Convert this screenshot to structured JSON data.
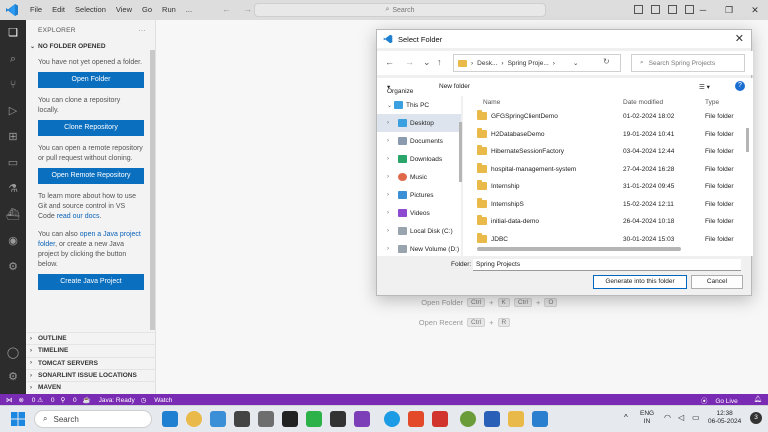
{
  "titlebar": {
    "menu": [
      "File",
      "Edit",
      "Selection",
      "View",
      "Go",
      "Run",
      "..."
    ],
    "search_placeholder": "Search"
  },
  "explorer": {
    "header": "EXPLORER",
    "section": "NO FOLDER OPENED",
    "text1": "You have not yet opened a folder.",
    "open_folder": "Open Folder",
    "text2": "You can clone a repository locally.",
    "clone_repo": "Clone Repository",
    "text3": "You can open a remote repository or pull request without cloning.",
    "open_remote": "Open Remote Repository",
    "text4_a": "To learn more about how to use Git and source control in VS Code ",
    "text4_link": "read our docs",
    "text4_b": ".",
    "text5_a": "You can also ",
    "text5_link": "open a Java project folder",
    "text5_b": ", or create a new Java project by clicking the button below.",
    "create_java": "Create Java Project",
    "bottom_sections": [
      "OUTLINE",
      "TIMELINE",
      "TOMCAT SERVERS",
      "SONARLINT ISSUE LOCATIONS",
      "MAVEN"
    ]
  },
  "editor": {
    "open_folder": "Open Folder",
    "open_folder_keys": [
      "Ctrl",
      "+",
      "K",
      "Ctrl",
      "+",
      "O"
    ],
    "open_recent": "Open Recent",
    "open_recent_keys": [
      "Ctrl",
      "+",
      "R"
    ]
  },
  "statusbar": {
    "errors": "0",
    "warnings": "0",
    "ports": "0",
    "java": "Java: Ready",
    "watch": "Watch",
    "go_live": "Go Live"
  },
  "dialog": {
    "title": "Select Folder",
    "breadcrumb": [
      "Desk...",
      "Spring Proje..."
    ],
    "search_placeholder": "Search Spring Projects",
    "organize": "Organize",
    "new_folder": "New folder",
    "tree": [
      "This PC",
      "Desktop",
      "Documents",
      "Downloads",
      "Music",
      "Pictures",
      "Videos",
      "Local Disk (C:)",
      "New Volume (D:)"
    ],
    "columns": [
      "Name",
      "Date modified",
      "Type"
    ],
    "files": [
      {
        "name": "GFGSpringClientDemo",
        "date": "01-02-2024 18:02",
        "type": "File folder"
      },
      {
        "name": "H2DatabaseDemo",
        "date": "19-01-2024 10:41",
        "type": "File folder"
      },
      {
        "name": "HibernateSessionFactory",
        "date": "03-04-2024 12:44",
        "type": "File folder"
      },
      {
        "name": "hospital-management-system",
        "date": "27-04-2024 16:28",
        "type": "File folder"
      },
      {
        "name": "Internship",
        "date": "31-01-2024 09:45",
        "type": "File folder"
      },
      {
        "name": "InternshipS",
        "date": "15-02-2024 12:11",
        "type": "File folder"
      },
      {
        "name": "initial-data-demo",
        "date": "26-04-2024 10:18",
        "type": "File folder"
      },
      {
        "name": "JDBC",
        "date": "30-01-2024 15:03",
        "type": "File folder"
      }
    ],
    "folder_label": "Folder:",
    "folder_value": "Spring Projects",
    "generate_btn": "Generate into this folder",
    "cancel_btn": "Cancel"
  },
  "taskbar": {
    "search": "Search",
    "lang1": "ENG",
    "lang2": "IN",
    "time": "12:38",
    "date": "06-05-2024",
    "notif": "3"
  }
}
